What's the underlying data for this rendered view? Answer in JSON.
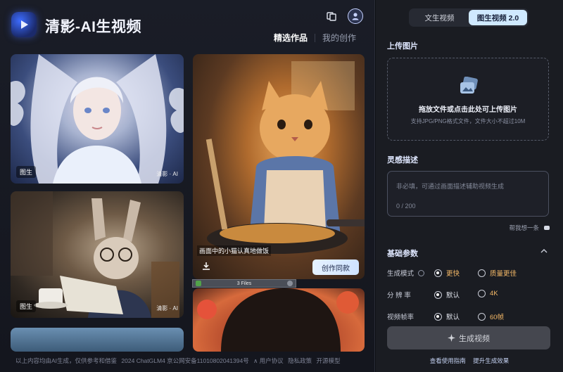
{
  "app": {
    "title": "清影-AI生视频"
  },
  "header": {
    "tabs": [
      {
        "label": "精选作品",
        "active": true
      },
      {
        "label": "我的创作",
        "active": false
      }
    ],
    "icons": {
      "switch": "layout-switch-icon",
      "user": "user-avatar-icon"
    }
  },
  "gallery": {
    "cards": [
      {
        "badge": "图生",
        "watermark": "清影 · AI"
      },
      {
        "caption": "画面中的小猫认真地做饭",
        "action": "创作同款"
      },
      {
        "badge": "图生",
        "watermark": "清影 · AI"
      }
    ],
    "floating_bar": {
      "label": "3 Files"
    }
  },
  "footer": {
    "items": [
      "以上内容均由AI生成，仅供参考和借鉴",
      "2024 ChatGLM4 京公网安备11010802041394号",
      "∧ 用户协议",
      "隐私政策",
      "开源模型"
    ]
  },
  "right": {
    "mode_tabs": [
      {
        "label": "文生视频",
        "active": false
      },
      {
        "label": "图生视频 2.0",
        "active": true
      }
    ],
    "upload": {
      "title": "上传图片",
      "prompt": "拖放文件或点击此处可上传图片",
      "hint": "支持JPG/PNG格式文件，文件大小不超过10M"
    },
    "inspiration": {
      "title": "灵感描述",
      "placeholder": "非必填，可通过画面描述辅助视频生成",
      "counter": "0 / 200",
      "help": "帮我想一条"
    },
    "params": {
      "title": "基础参数",
      "rows": [
        {
          "label": "生成模式",
          "options": [
            "更快",
            "质量更佳"
          ],
          "selected": 0
        },
        {
          "label": "分 辨 率",
          "options": [
            "默认",
            "4K"
          ],
          "selected": 0
        },
        {
          "label": "视频帧率",
          "options": [
            "默认",
            "60帧"
          ],
          "selected": 0
        }
      ]
    },
    "generate_button": "生成视频",
    "links": [
      "查看使用指南",
      "提升生成效果"
    ]
  }
}
